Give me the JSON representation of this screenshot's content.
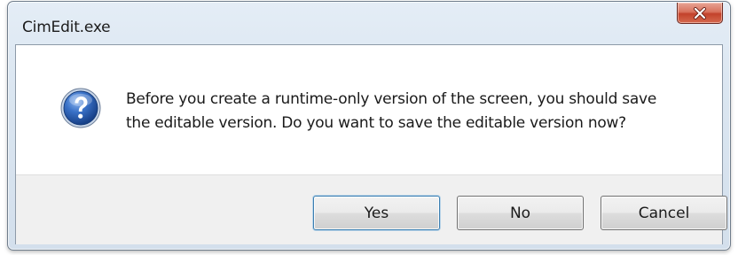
{
  "dialog": {
    "title": "CimEdit.exe",
    "close_label": "X",
    "icon": "question-icon",
    "message_lines": [
      "Before you create a runtime-only version of the screen, you should save",
      "the editable version. Do you want to save the editable version now?"
    ],
    "buttons": {
      "yes": "Yes",
      "no": "No",
      "cancel": "Cancel"
    }
  },
  "colors": {
    "title_bar": "#dbe6f1",
    "close_button": "#c9503a",
    "question_icon": "#2a5fb0",
    "button_bar": "#f0f0f0"
  }
}
